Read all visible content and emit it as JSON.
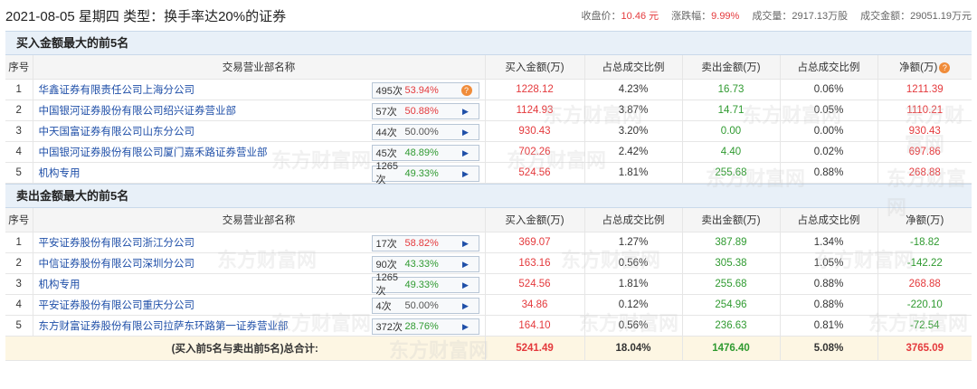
{
  "header": {
    "title": "2021-08-05 星期四 类型：换手率达20%的证券",
    "close_label": "收盘价：",
    "close_value": "10.46 元",
    "change_label": "涨跌幅：",
    "change_value": "9.99%",
    "volume_label": "成交量：",
    "volume_value": "2917.13万股",
    "amount_label": "成交金额：",
    "amount_value": "29051.19万元"
  },
  "watermark": "东方财富网",
  "buy": {
    "title": "买入金额最大的前5名",
    "columns": [
      "序号",
      "交易营业部名称",
      "买入金额(万)",
      "占总成交比例",
      "卖出金额(万)",
      "占总成交比例",
      "净额(万)"
    ],
    "rows": [
      {
        "no": "1",
        "name": "华鑫证券有限责任公司上海分公司",
        "count": "495次",
        "pct": "53.94%",
        "buy": "1228.12",
        "buy_ratio": "4.23%",
        "sell": "16.73",
        "sell_ratio": "0.06%",
        "net": "1211.39",
        "special": true
      },
      {
        "no": "2",
        "name": "中国银河证券股份有限公司绍兴证券营业部",
        "count": "57次",
        "pct": "50.88%",
        "buy": "1124.93",
        "buy_ratio": "3.87%",
        "sell": "14.71",
        "sell_ratio": "0.05%",
        "net": "1110.21"
      },
      {
        "no": "3",
        "name": "中天国富证券有限公司山东分公司",
        "count": "44次",
        "pct": "50.00%",
        "buy": "930.43",
        "buy_ratio": "3.20%",
        "sell": "0.00",
        "sell_ratio": "0.00%",
        "net": "930.43",
        "pct_dark": true
      },
      {
        "no": "4",
        "name": "中国银河证券股份有限公司厦门嘉禾路证券营业部",
        "count": "45次",
        "pct": "48.89%",
        "buy": "702.26",
        "buy_ratio": "2.42%",
        "sell": "4.40",
        "sell_ratio": "0.02%",
        "net": "697.86",
        "pct_green": true
      },
      {
        "no": "5",
        "name": "机构专用",
        "count": "1265次",
        "pct": "49.33%",
        "buy": "524.56",
        "buy_ratio": "1.81%",
        "sell": "255.68",
        "sell_ratio": "0.88%",
        "net": "268.88",
        "pct_green": true
      }
    ]
  },
  "sell": {
    "title": "卖出金额最大的前5名",
    "columns": [
      "序号",
      "交易营业部名称",
      "买入金额(万)",
      "占总成交比例",
      "卖出金额(万)",
      "占总成交比例",
      "净额(万)"
    ],
    "rows": [
      {
        "no": "1",
        "name": "平安证券股份有限公司浙江分公司",
        "count": "17次",
        "pct": "58.82%",
        "buy": "369.07",
        "buy_ratio": "1.27%",
        "sell": "387.89",
        "sell_ratio": "1.34%",
        "net": "-18.82"
      },
      {
        "no": "2",
        "name": "中信证券股份有限公司深圳分公司",
        "count": "90次",
        "pct": "43.33%",
        "buy": "163.16",
        "buy_ratio": "0.56%",
        "sell": "305.38",
        "sell_ratio": "1.05%",
        "net": "-142.22",
        "pct_green": true
      },
      {
        "no": "3",
        "name": "机构专用",
        "count": "1265次",
        "pct": "49.33%",
        "buy": "524.56",
        "buy_ratio": "1.81%",
        "sell": "255.68",
        "sell_ratio": "0.88%",
        "net": "268.88",
        "pct_green": true
      },
      {
        "no": "4",
        "name": "平安证券股份有限公司重庆分公司",
        "count": "4次",
        "pct": "50.00%",
        "buy": "34.86",
        "buy_ratio": "0.12%",
        "sell": "254.96",
        "sell_ratio": "0.88%",
        "net": "-220.10",
        "pct_dark": true
      },
      {
        "no": "5",
        "name": "东方财富证券股份有限公司拉萨东环路第一证券营业部",
        "count": "372次",
        "pct": "28.76%",
        "buy": "164.10",
        "buy_ratio": "0.56%",
        "sell": "236.63",
        "sell_ratio": "0.81%",
        "net": "-72.54",
        "pct_green": true
      }
    ]
  },
  "total": {
    "label": "(买入前5名与卖出前5名)总合计:",
    "buy": "5241.49",
    "buy_ratio": "18.04%",
    "sell": "1476.40",
    "sell_ratio": "5.08%",
    "net": "3765.09"
  },
  "colors": {
    "red": "#e4393c",
    "green": "#2f9a30",
    "link": "#1f4fa8"
  }
}
